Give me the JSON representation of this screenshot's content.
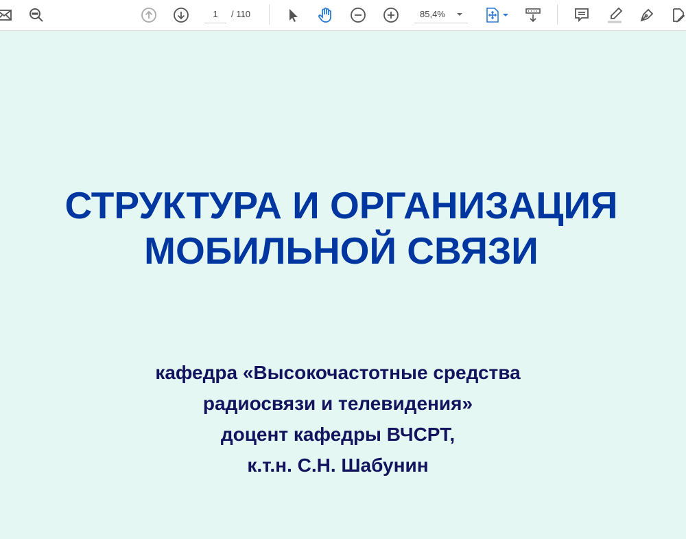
{
  "toolbar": {
    "page_current": "1",
    "page_total": "/ 110",
    "zoom_level": "85,4%",
    "accent_color": "#2b7bd4"
  },
  "slide": {
    "title_lines": [
      "СТРУКТУРА И ОРГАНИЗАЦИЯ",
      "МОБИЛЬНОЙ СВЯЗИ"
    ],
    "subtitle_lines": [
      "кафедра «Высокочастотные средства",
      "радиосвязи и телевидения»",
      "доцент кафедры ВЧСРТ,",
      "к.т.н. С.Н. Шабунин"
    ],
    "title_color": "#0036a0",
    "subtitle_color": "#14145e",
    "background_color": "#e4f7f2"
  }
}
